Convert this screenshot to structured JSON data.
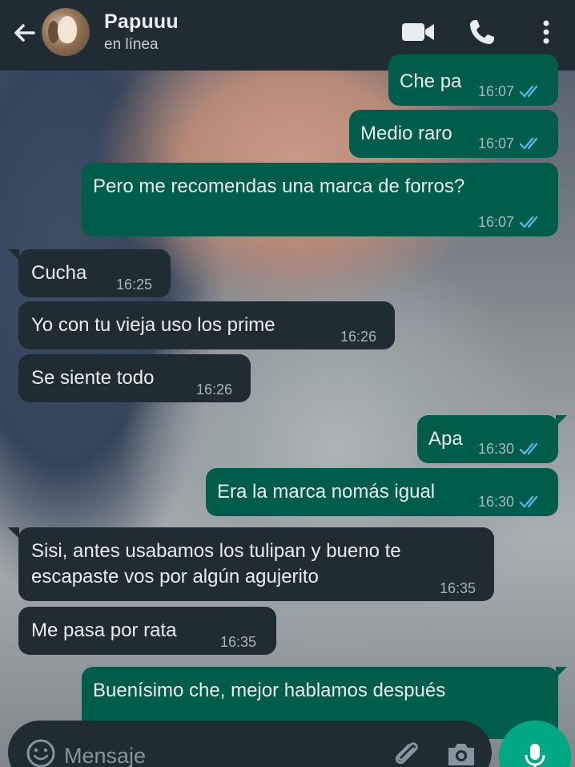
{
  "header": {
    "contact_name": "Papuuu",
    "status": "en línea",
    "icons": [
      "back-arrow-icon",
      "video-call-icon",
      "phone-icon",
      "more-options-icon"
    ]
  },
  "messages": [
    {
      "direction": "out",
      "text": "Che pa",
      "time": "16:07",
      "read": true
    },
    {
      "direction": "out",
      "text": "Medio raro",
      "time": "16:07",
      "read": true
    },
    {
      "direction": "out",
      "text": "Pero me recomendas una marca de forros?",
      "time": "16:07",
      "read": true
    },
    {
      "direction": "in",
      "text": "Cucha",
      "time": "16:25"
    },
    {
      "direction": "in",
      "text": "Yo con tu vieja uso los prime",
      "time": "16:26"
    },
    {
      "direction": "in",
      "text": "Se siente todo",
      "time": "16:26"
    },
    {
      "direction": "out",
      "text": "Apa",
      "time": "16:30",
      "read": true
    },
    {
      "direction": "out",
      "text": "Era la marca nomás igual",
      "time": "16:30",
      "read": true
    },
    {
      "direction": "in",
      "text_lines": [
        "Sisi, antes usabamos los tulipan y bueno te",
        "escapaste vos por algún agujerito"
      ],
      "time": "16:35"
    },
    {
      "direction": "in",
      "text": "Me pasa por rata",
      "time": "16:35"
    },
    {
      "direction": "out",
      "text": "Buenísimo che, mejor hablamos después"
    }
  ],
  "composer": {
    "placeholder": "Mensaje"
  },
  "colors": {
    "header_bg": "#1f2c34",
    "outgoing_bubble": "#005c4b",
    "incoming_bubble": "#1f2c34",
    "read_ticks": "#53bdeb",
    "mic_button": "#00a884"
  }
}
